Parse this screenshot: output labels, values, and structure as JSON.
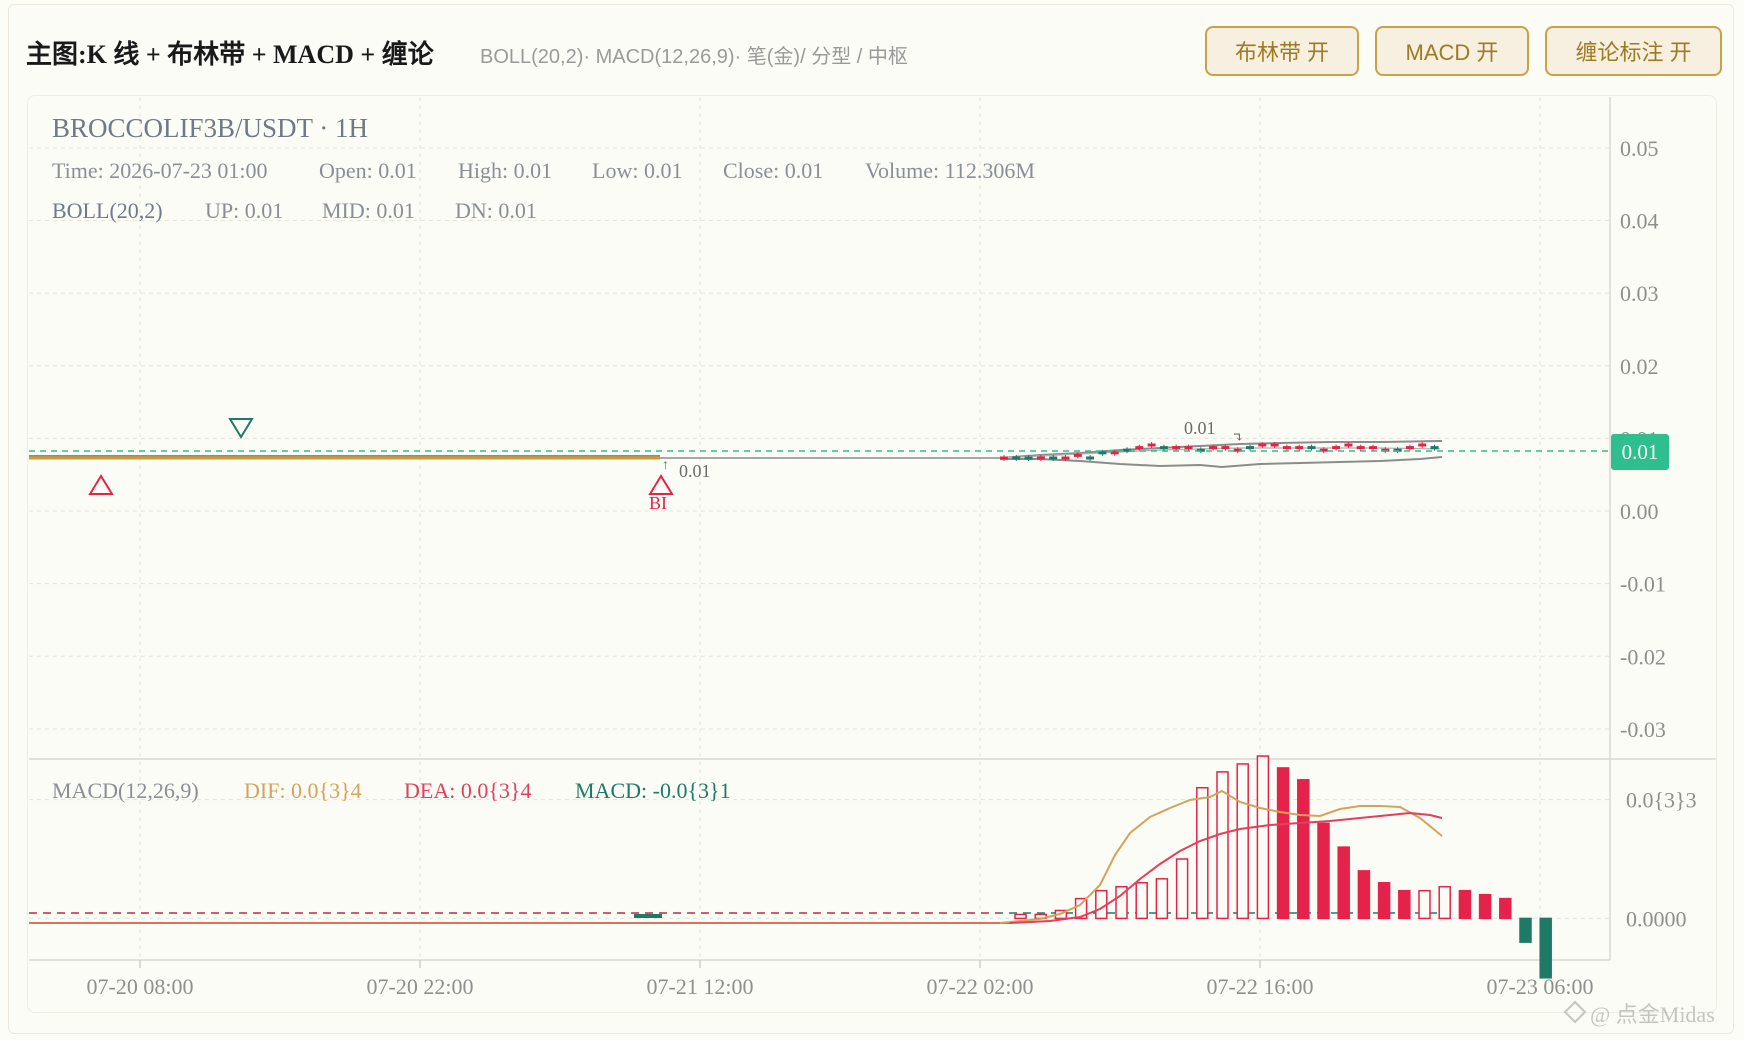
{
  "header": {
    "title": "主图:K 线 + 布林带 + MACD + 缠论",
    "subtitle": "BOLL(20,2)· MACD(12,26,9)· 笔(金)/ 分型 / 中枢",
    "buttons": {
      "boll": "布林带 开",
      "macd": "MACD 开",
      "chan": "缠论标注 开"
    }
  },
  "info": {
    "symbol": "BROCCOLIF3B/USDT · 1H",
    "time": "Time: 2026-07-23 01:00",
    "open": "Open: 0.01",
    "high": "High: 0.01",
    "low": "Low: 0.01",
    "close": "Close: 0.01",
    "volume": "Volume: 112.306M",
    "boll_label": "BOLL(20,2)",
    "boll_up": "UP: 0.01",
    "boll_mid": "MID: 0.01",
    "boll_dn": "DN: 0.01"
  },
  "macd_info": {
    "label": "MACD(12,26,9)",
    "dif": "DIF: 0.0{3}4",
    "dea": "DEA: 0.0{3}4",
    "macd": "MACD: -0.0{3}1"
  },
  "annotations": {
    "bi_label": "BI",
    "low_value": "0.01",
    "high_value": "0.01"
  },
  "watermark": "@ 点金Midas",
  "colors": {
    "up": "#e5234a",
    "down": "#1e7a67",
    "dif": "#d4a35a",
    "dea": "#e0405d",
    "price_tag": "#2fbf8f",
    "boll_band": "#8c8c8c",
    "chan_stroke": "#d49a2a"
  },
  "chart_data": {
    "type": "candlestick",
    "symbol": "BROCCOLIF3B/USDT",
    "interval": "1H",
    "x_ticks": [
      "07-20 08:00",
      "07-20 22:00",
      "07-21 12:00",
      "07-22 02:00",
      "07-22 16:00",
      "07-23 06:00"
    ],
    "y_ticks": [
      "0.05",
      "0.04",
      "0.03",
      "0.02",
      "0.01",
      "0.00",
      "-0.01",
      "-0.02",
      "-0.03"
    ],
    "ylim": [
      -0.034,
      0.057
    ],
    "last_price": 0.01,
    "last_price_label": "0.01",
    "candles_note": "flat near 0.0055 until 07-22 01:00, small rise to ~0.007 afterwards",
    "macd_y_ticks": [
      "0.0{3}3",
      "0.0000"
    ],
    "macd_ylim": [
      -0.0001,
      0.0004
    ],
    "macd_histogram": [
      1e-05,
      1e-05,
      2e-05,
      5e-05,
      7e-05,
      8e-05,
      9e-05,
      0.0001,
      0.00015,
      0.00033,
      0.00037,
      0.00039,
      0.00041,
      0.00038,
      0.00035,
      0.00024,
      0.00018,
      0.00012,
      9e-05,
      7e-05,
      7e-05,
      8e-05,
      7e-05,
      6e-05,
      5e-05,
      -6e-05,
      -0.00015
    ],
    "histogram_start": "07-22 02:00",
    "dif_note": "rises from 0 at 07-22 06:00 to peak ~0.00039 near 07-22 12:00, then ~0.00030",
    "dea_note": "rises to ~0.00030 at 07-22 22:00, then slightly down to 0.00028"
  }
}
